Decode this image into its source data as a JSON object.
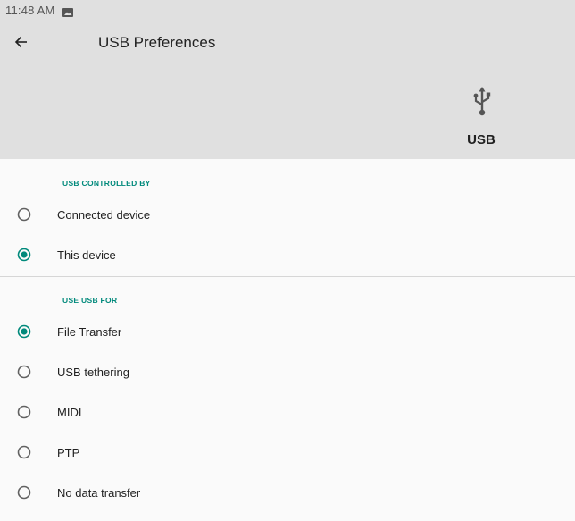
{
  "status_bar": {
    "time": "11:48 AM",
    "notification_icon": "image-icon"
  },
  "app_bar": {
    "back_icon": "arrow-back-icon",
    "title": "USB Preferences",
    "header_icon": "usb-icon",
    "header_label": "USB"
  },
  "sections": [
    {
      "header": "USB CONTROLLED BY",
      "options": [
        {
          "label": "Connected device",
          "selected": false
        },
        {
          "label": "This device",
          "selected": true
        }
      ]
    },
    {
      "header": "USE USB FOR",
      "options": [
        {
          "label": "File Transfer",
          "selected": true
        },
        {
          "label": "USB tethering",
          "selected": false
        },
        {
          "label": "MIDI",
          "selected": false
        },
        {
          "label": "PTP",
          "selected": false
        },
        {
          "label": "No data transfer",
          "selected": false
        }
      ]
    }
  ],
  "colors": {
    "accent": "#00897b",
    "header_bg": "#e0e0e0",
    "background": "#fafafa",
    "radio_unselected": "#616161"
  }
}
